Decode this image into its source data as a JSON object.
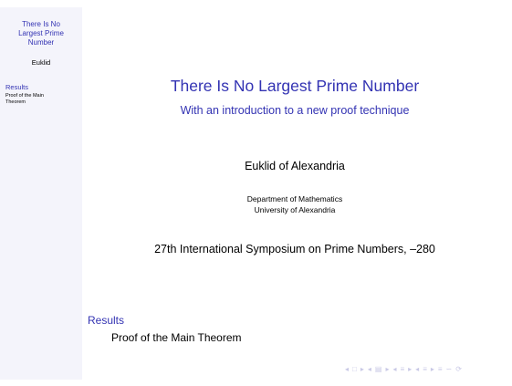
{
  "sidebar": {
    "title_lines": [
      "There Is No",
      "Largest Prime",
      "Number"
    ],
    "author": "Euklid",
    "section": "Results",
    "subsection_lines": [
      "Proof of the Main",
      "Theorem"
    ]
  },
  "titlepage": {
    "title": "There Is No Largest Prime Number",
    "subtitle": "With an introduction to a new proof technique",
    "author": "Euklid of Alexandria",
    "institute_lines": [
      "Department of Mathematics",
      "University of Alexandria"
    ],
    "date": "27th International Symposium on Prime Numbers, –280"
  },
  "toc": {
    "section": "Results",
    "subsection": "Proof of the Main Theorem"
  },
  "navigation": {
    "icons": [
      "nav-frame-left-icon",
      "nav-frame-right-icon",
      "nav-subsection-left-icon",
      "nav-subsection-right-icon",
      "nav-section-left-icon",
      "nav-section-right-icon",
      "nav-presentation-left-icon",
      "nav-presentation-right-icon",
      "nav-appendix-icon",
      "nav-search-icon"
    ],
    "glyphs": [
      "◂",
      "□",
      "▸",
      "◂",
      "▤",
      "▸",
      "◂",
      "≡",
      "▸",
      "◂",
      "≡",
      "▸",
      "≡",
      "∽",
      "⟳"
    ]
  },
  "colors": {
    "accent": "#3333b3",
    "sidebar_bg": "#f4f4fb",
    "nav_icons": "#c9c9e6"
  }
}
